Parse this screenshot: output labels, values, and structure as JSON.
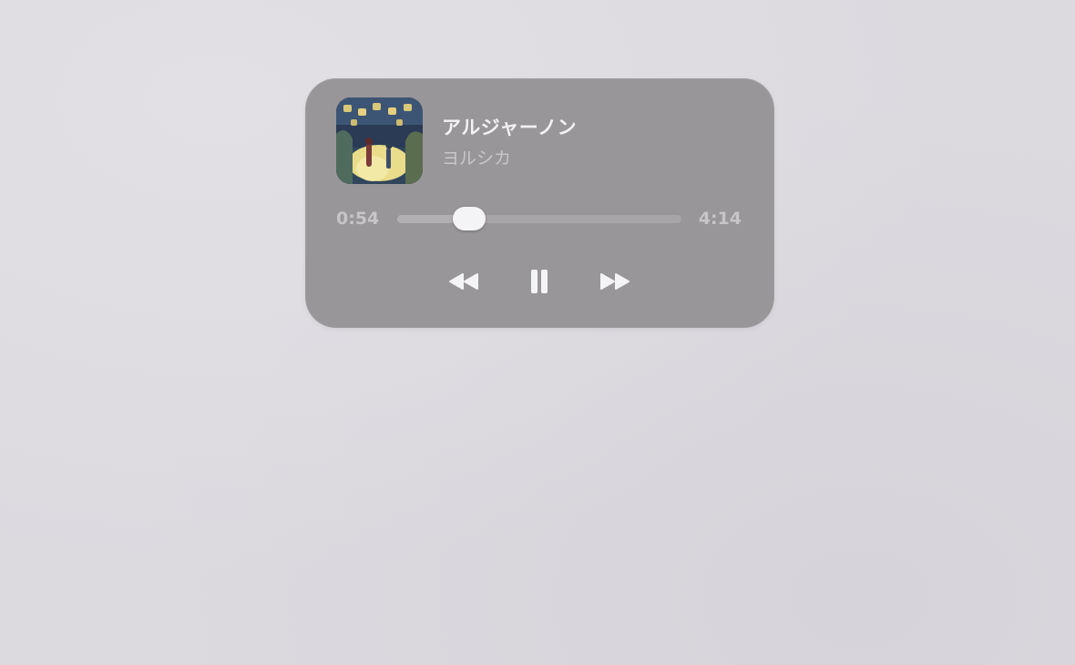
{
  "now_playing": {
    "title": "アルジャーノン",
    "artist": "ヨルシカ",
    "artwork_icon": "album-artwork"
  },
  "progress": {
    "elapsed": "0:54",
    "total": "4:14",
    "fraction": 0.2126
  },
  "controls": {
    "rewind_icon": "rewind-icon",
    "pause_icon": "pause-icon",
    "forward_icon": "fast-forward-icon"
  },
  "colors": {
    "panel": "#999699",
    "text_primary": "#f2f1f3",
    "text_secondary": "#c9c6ca",
    "icon": "#f4f3f5"
  }
}
